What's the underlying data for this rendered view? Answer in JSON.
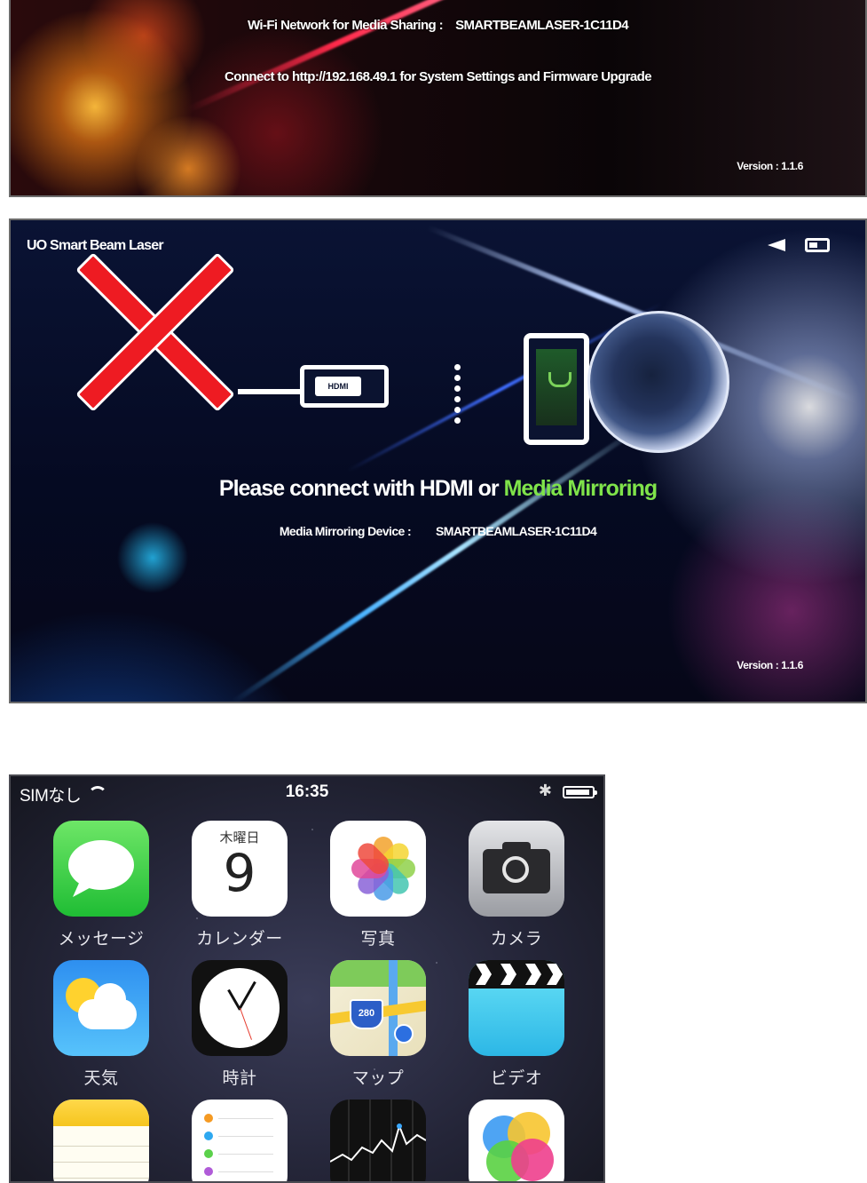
{
  "projector_network_screen": {
    "wifi_label": "Wi-Fi Network for Media Sharing :",
    "wifi_ssid": "SMARTBEAMLASER-1C11D4",
    "connect_prefix": "Connect to",
    "connect_url": "http://192.168.49.1",
    "connect_suffix": "for System Settings and Firmware Upgrade",
    "version": "Version : 1.1.6"
  },
  "projector_mirroring_screen": {
    "title": "UO Smart Beam Laser",
    "hdmi_label": "HDMI",
    "message_prefix": "Please connect with HDMI or",
    "message_accent": "Media Mirroring",
    "device_label": "Media Mirroring Device :",
    "device_name": "SMARTBEAMLASER-1C11D4",
    "version": "Version : 1.1.6"
  },
  "iphone_home": {
    "status": {
      "carrier": "SIMなし",
      "time": "16:35"
    },
    "calendar": {
      "weekday": "木曜日",
      "day": "9"
    },
    "maps_shield": "280",
    "apps": [
      {
        "label": "メッセージ"
      },
      {
        "label": "カレンダー"
      },
      {
        "label": "写真"
      },
      {
        "label": "カメラ"
      },
      {
        "label": "天気"
      },
      {
        "label": "時計"
      },
      {
        "label": "マップ"
      },
      {
        "label": "ビデオ"
      },
      {
        "label": ""
      },
      {
        "label": ""
      },
      {
        "label": ""
      },
      {
        "label": ""
      }
    ]
  }
}
